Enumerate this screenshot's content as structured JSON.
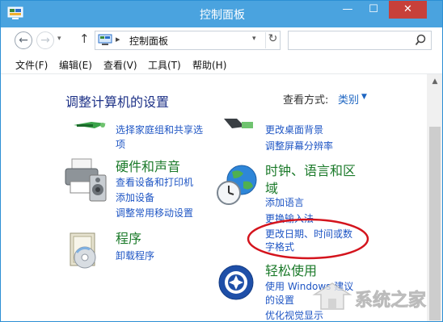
{
  "window": {
    "title": "控制面板",
    "minimize_label": "—",
    "maximize_label": "☐",
    "close_label": "✕"
  },
  "address": {
    "back_label": "←",
    "forward_label": "→",
    "history_label": "▾",
    "up_label": "↑",
    "separator": "▸",
    "path": "控制面板",
    "dropdown_label": "▾",
    "refresh_label": "↻",
    "search_value": ""
  },
  "menu": {
    "items": [
      {
        "label": "文件(F)"
      },
      {
        "label": "编辑(E)"
      },
      {
        "label": "查看(V)"
      },
      {
        "label": "工具(T)"
      },
      {
        "label": "帮助(H)"
      }
    ]
  },
  "main": {
    "title": "调整计算机的设置",
    "view_label": "查看方式:",
    "view_value": "类别",
    "view_arrow": "▼"
  },
  "categories": {
    "family": {
      "links": [
        "选择家庭组和共享选",
        "项"
      ]
    },
    "hardware": {
      "title": "硬件和声音",
      "links": [
        "查看设备和打印机",
        "添加设备",
        "调整常用移动设置"
      ]
    },
    "programs": {
      "title": "程序",
      "links": [
        "卸载程序"
      ]
    },
    "appearance": {
      "links": [
        "更改桌面背景",
        "调整屏幕分辨率"
      ]
    },
    "clock": {
      "title_line1": "时钟、语言和区",
      "title_line2": "域",
      "links": [
        "添加语言",
        "更换输入法",
        "更改日期、时间或数",
        "字格式"
      ]
    },
    "ease": {
      "title": "轻松使用",
      "links": [
        "使用 Windows 建议",
        "的设置",
        "优化视觉显示"
      ]
    }
  },
  "scrollbar": {
    "up_label": "▲"
  },
  "watermark": {
    "text": "系统之家"
  },
  "colors": {
    "titlebar": "#4aa3df",
    "close_button": "#c7403a",
    "link": "#1e55c4",
    "category_title": "#1b7a2a",
    "page_title": "#1e3287",
    "annotation": "#d4141d"
  }
}
